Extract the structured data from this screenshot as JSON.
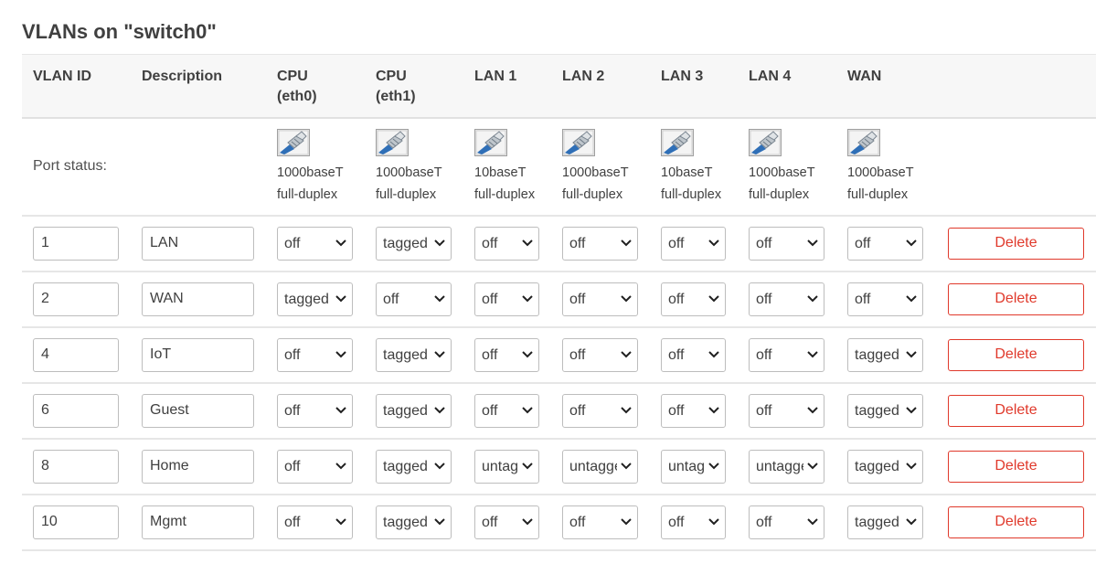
{
  "title": "VLANs on \"switch0\"",
  "columns": {
    "vlan_id": "VLAN ID",
    "description": "Description",
    "ports": [
      {
        "line1": "CPU",
        "line2": "(eth0)"
      },
      {
        "line1": "CPU",
        "line2": "(eth1)"
      },
      {
        "line1": "LAN 1",
        "line2": ""
      },
      {
        "line1": "LAN 2",
        "line2": ""
      },
      {
        "line1": "LAN 3",
        "line2": ""
      },
      {
        "line1": "LAN 4",
        "line2": ""
      },
      {
        "line1": "WAN",
        "line2": ""
      }
    ]
  },
  "port_status": {
    "label": "Port status:",
    "icon": "ethernet-port-icon",
    "ports": [
      {
        "speed": "1000baseT",
        "duplex": "full-duplex"
      },
      {
        "speed": "1000baseT",
        "duplex": "full-duplex"
      },
      {
        "speed": "10baseT",
        "duplex": "full-duplex"
      },
      {
        "speed": "1000baseT",
        "duplex": "full-duplex"
      },
      {
        "speed": "10baseT",
        "duplex": "full-duplex"
      },
      {
        "speed": "1000baseT",
        "duplex": "full-duplex"
      },
      {
        "speed": "1000baseT",
        "duplex": "full-duplex"
      }
    ]
  },
  "vlans": [
    {
      "id": "1",
      "description": "LAN",
      "ports": [
        "off",
        "tagged",
        "off",
        "off",
        "off",
        "off",
        "off"
      ]
    },
    {
      "id": "2",
      "description": "WAN",
      "ports": [
        "tagged",
        "off",
        "off",
        "off",
        "off",
        "off",
        "off"
      ]
    },
    {
      "id": "4",
      "description": "IoT",
      "ports": [
        "off",
        "tagged",
        "off",
        "off",
        "off",
        "off",
        "tagged"
      ]
    },
    {
      "id": "6",
      "description": "Guest",
      "ports": [
        "off",
        "tagged",
        "off",
        "off",
        "off",
        "off",
        "tagged"
      ]
    },
    {
      "id": "8",
      "description": "Home",
      "ports": [
        "off",
        "tagged",
        "untagged",
        "untagged",
        "untagged",
        "untagged",
        "tagged"
      ]
    },
    {
      "id": "10",
      "description": "Mgmt",
      "ports": [
        "off",
        "tagged",
        "off",
        "off",
        "off",
        "off",
        "tagged"
      ]
    }
  ],
  "port_options": [
    "off",
    "untagged",
    "tagged"
  ],
  "delete_label": "Delete",
  "colors": {
    "delete_accent": "#e0392b",
    "header_bg": "#f7f7f7"
  }
}
